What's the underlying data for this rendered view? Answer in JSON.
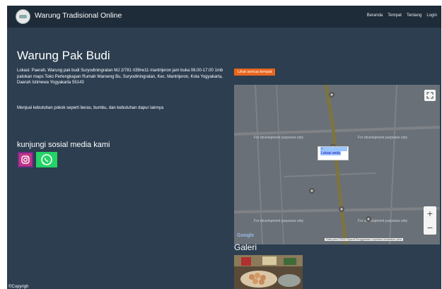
{
  "navbar": {
    "brand": "Warung Tradisional Online",
    "links": [
      "Beranda",
      "Tempat",
      "Tentang",
      "Login"
    ]
  },
  "main": {
    "title": "Warung Pak Budi",
    "address": "Lokasi: Paerah, Warung pak budi Suryodiningratan MJ 2/781 rt39rw11 mantrijeron jam buka 08.00-17.00 1mb patokan maps Toko Perlengkapan Rumah Waroeng Bu, Suryodiningratan, Kec. Mantrijeron, Kota Yogyakarta, Daerah Istimewa Yogyakarta 55143",
    "description": "Menjual kebutuhan pokok seperti beras, bumbu, dan kebutuhan dapur lainnya",
    "social_title": "kunjungi sosial media kami"
  },
  "map": {
    "view_all_label": "Lihat semua tempat",
    "popup_label": "Lokasi anda",
    "labels": [
      "For development purposes only",
      "For development purposes only",
      "For development purposes only",
      "For development purposes only"
    ],
    "google_label": "Google",
    "terms": "Data peta ©2022    Syarat Penggunaan    Laporkan kesalahan peta",
    "zoom_in": "+",
    "zoom_out": "−"
  },
  "gallery": {
    "title": "Galeri"
  },
  "footer": {
    "text": "©Copyrigh"
  },
  "colors": {
    "background": "#2c3e50",
    "navbar": "#1e2b38",
    "accent_orange": "#e8661e",
    "instagram": "#c13584",
    "whatsapp": "#25d366"
  },
  "icons": {
    "instagram": "instagram-icon",
    "whatsapp": "whatsapp-icon",
    "fullscreen": "fullscreen-icon",
    "map_marker": "map-marker-icon"
  }
}
